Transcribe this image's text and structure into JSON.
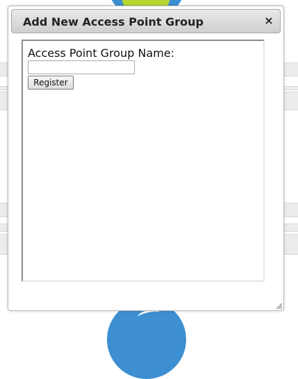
{
  "dialog": {
    "title": "Add New Access Point Group",
    "close_icon": "×",
    "close_icon_name": "close-icon"
  },
  "form": {
    "label": "Access Point Group Name:",
    "input_value": "",
    "input_placeholder": "",
    "register_label": "Register"
  },
  "colors": {
    "titlebar_top": "#e9e9e9",
    "titlebar_bottom": "#cfcfcf",
    "background_accent_blue": "#3d8fd1",
    "background_accent_green": "#b7d630"
  },
  "icons": {
    "resize": "resize-grip-icon"
  }
}
